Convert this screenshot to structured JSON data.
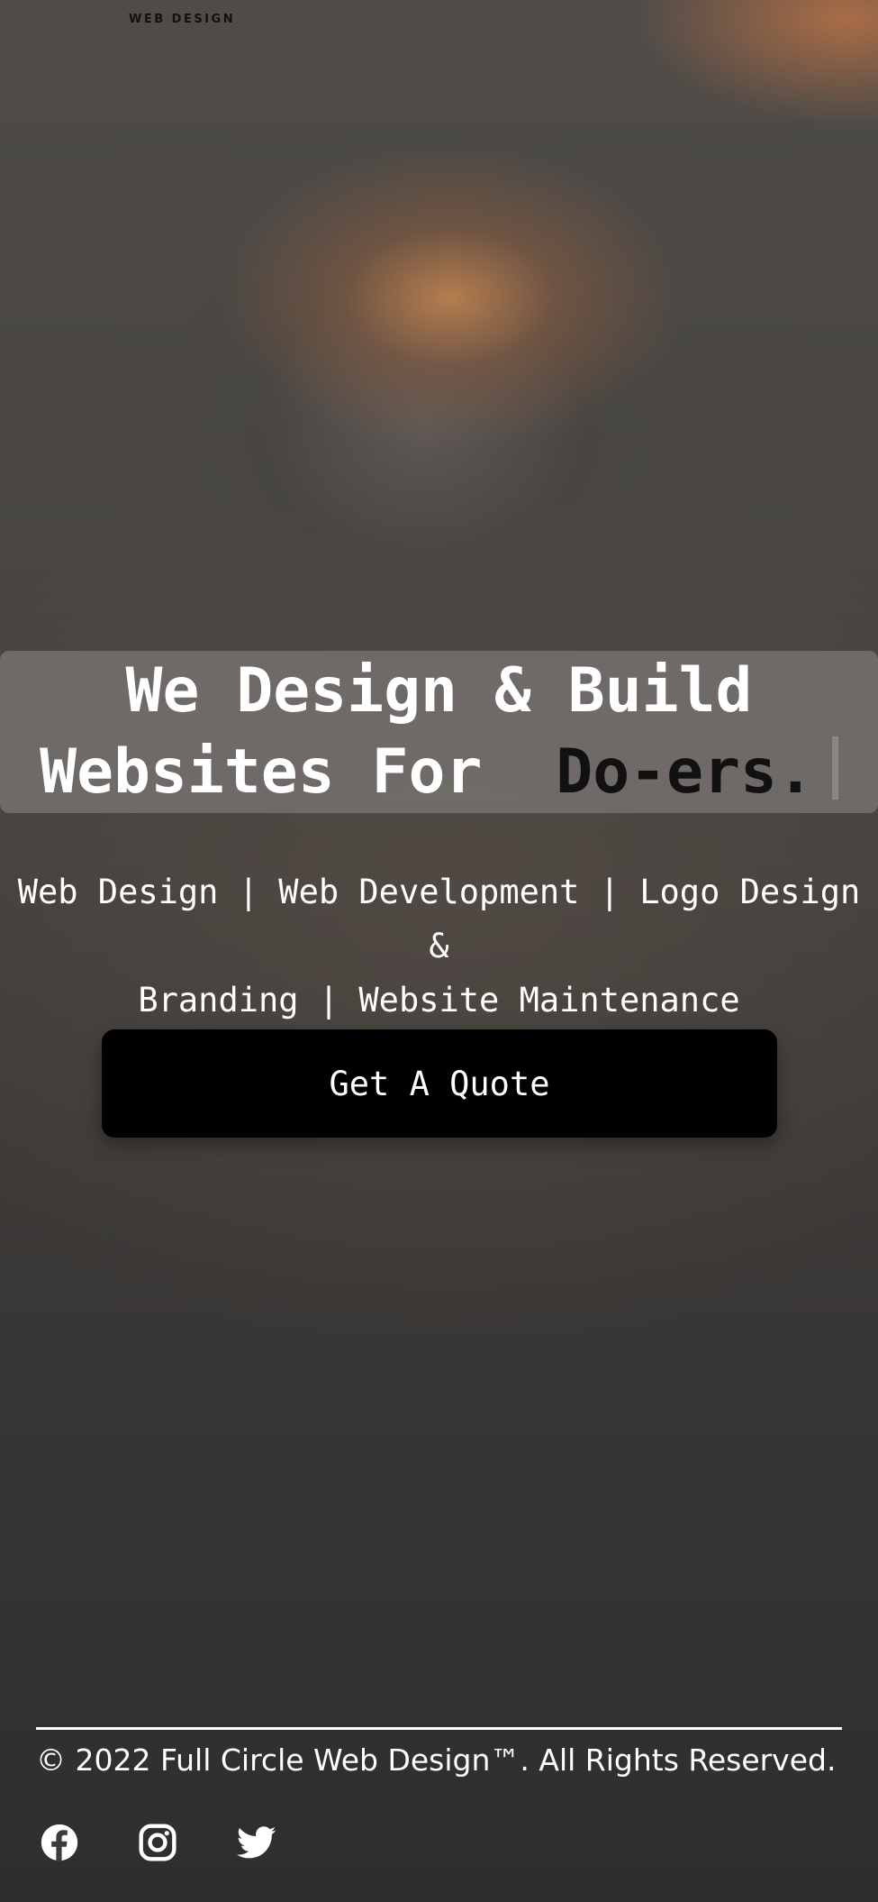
{
  "header": {
    "logo_subtitle": "WEB DESIGN"
  },
  "hero": {
    "title_line1": "We Design & Build",
    "title_line2_prefix": "Websites For ",
    "title_typed_word": "Do-ers.",
    "services_line1": "Web Design | Web Development | Logo Design &",
    "services_line2": "Branding | Website Maintenance",
    "cta_label": "Get A Quote"
  },
  "footer": {
    "copyright": "© 2022 Full Circle Web Design™. All Rights Reserved.",
    "social_icons": [
      "facebook-icon",
      "instagram-icon",
      "twitter-icon"
    ]
  },
  "colors": {
    "cta_background": "#000000",
    "typed_word": "#111111",
    "text": "#ffffff"
  }
}
